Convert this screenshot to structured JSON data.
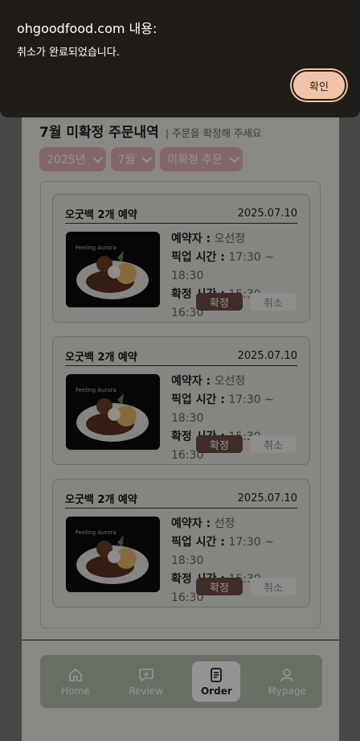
{
  "page": {
    "title": "7월 미확정 주문내역",
    "subtitle": "| 주문을 확정해 주세요",
    "filters": [
      "2025년",
      "7월",
      "미확정 주문"
    ]
  },
  "orders": [
    {
      "name": "오굿백 2개 예약",
      "date": "2025.07.10",
      "reserver_label": "예약자 :",
      "reserver": "오선정",
      "pickup_label": "픽업 시간 :",
      "pickup": "17:30 ~ 18:30",
      "confirm_label": "확정 시간 :",
      "confirm_time": "15:30 ~ 16:30",
      "confirm_btn": "확정",
      "cancel_btn": "취소"
    },
    {
      "name": "오굿백 2개 예약",
      "date": "2025.07.10",
      "reserver_label": "예약자 :",
      "reserver": "오선정",
      "pickup_label": "픽업 시간 :",
      "pickup": "17:30 ~ 18:30",
      "confirm_label": "확정 시간 :",
      "confirm_time": "15:30 ~ 16:30",
      "confirm_btn": "확정",
      "cancel_btn": "취소"
    },
    {
      "name": "오굿백 2개 예약",
      "date": "2025.07.10",
      "reserver_label": "예약자 :",
      "reserver": "선정",
      "pickup_label": "픽업 시간 :",
      "pickup": "17:30 ~ 18:30",
      "confirm_label": "확정 시간 :",
      "confirm_time": "15:30 ~ 16:30",
      "confirm_btn": "확정",
      "cancel_btn": "취소"
    }
  ],
  "nav": [
    {
      "label": "Home",
      "icon": "home-icon"
    },
    {
      "label": "Review",
      "icon": "review-icon"
    },
    {
      "label": "Order",
      "icon": "order-icon",
      "active": true
    },
    {
      "label": "Mypage",
      "icon": "mypage-icon"
    }
  ],
  "dialog": {
    "title": "ohgoodfood.com 내용:",
    "message": "취소가 완료되었습니다.",
    "ok_label": "확인"
  },
  "colors": {
    "accent": "#e4b2b6",
    "nav": "#b3c2b0",
    "confirm": "#6e4c48",
    "dialog_bg": "#221c19",
    "dialog_btn": "#f1c4a8"
  }
}
